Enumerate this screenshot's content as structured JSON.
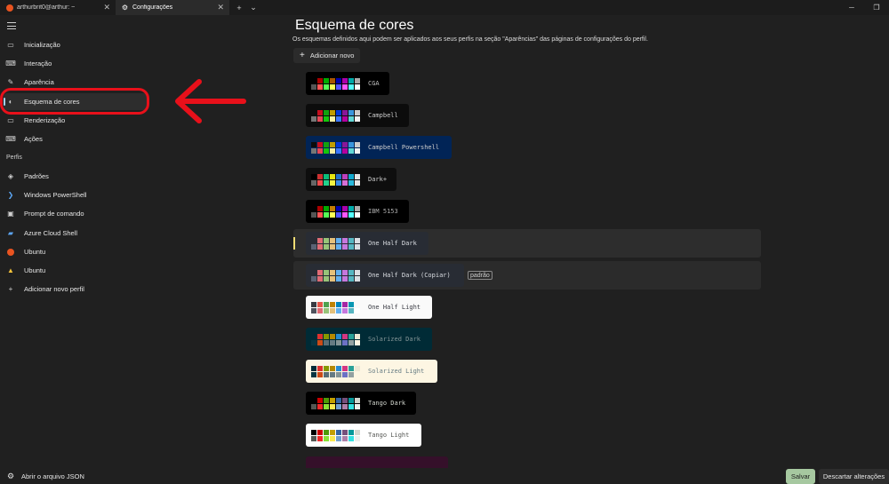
{
  "tabs": [
    {
      "label": "arthurbrit0@arthur: ~",
      "icon": "ubuntu-icon"
    },
    {
      "label": "Configurações",
      "icon": "gear-icon"
    }
  ],
  "tab_controls": {
    "new_tab": "+",
    "dropdown": "⌄"
  },
  "sidebar": {
    "items": [
      {
        "label": "Inicialização",
        "icon": "startup-icon"
      },
      {
        "label": "Interação",
        "icon": "interaction-icon"
      },
      {
        "label": "Aparência",
        "icon": "brush-icon"
      },
      {
        "label": "Esquema de cores",
        "icon": "palette-icon"
      },
      {
        "label": "Renderização",
        "icon": "monitor-icon"
      },
      {
        "label": "Ações",
        "icon": "keyboard-icon"
      }
    ],
    "profiles_label": "Perfis",
    "profiles": [
      {
        "label": "Padrões",
        "icon": "layers-icon"
      },
      {
        "label": "Windows PowerShell",
        "icon": "powershell-icon"
      },
      {
        "label": "Prompt de comando",
        "icon": "cmd-icon"
      },
      {
        "label": "Azure Cloud Shell",
        "icon": "azure-icon"
      },
      {
        "label": "Ubuntu",
        "icon": "ubuntu-icon"
      },
      {
        "label": "Ubuntu",
        "icon": "linux-icon"
      },
      {
        "label": "Adicionar novo perfil",
        "icon": "plus-icon"
      }
    ]
  },
  "main": {
    "title": "Esquema de cores",
    "description": "Os esquemas definidos aqui podem ser aplicados aos seus perfis na seção \"Aparências\" das páginas de configurações do perfil.",
    "add_new_label": "Adicionar novo",
    "schemes": [
      {
        "name": "CGA",
        "bg": "#000000",
        "fg": "#c0c0c0",
        "colors": [
          "#000000",
          "#aa0000",
          "#00aa00",
          "#aa5500",
          "#0000aa",
          "#aa00aa",
          "#00aaaa",
          "#aaaaaa",
          "#555555",
          "#ff5555",
          "#55ff55",
          "#ffff55",
          "#5555ff",
          "#ff55ff",
          "#55ffff",
          "#ffffff"
        ]
      },
      {
        "name": "Campbell",
        "bg": "#0c0c0c",
        "fg": "#cccccc",
        "colors": [
          "#0c0c0c",
          "#c50f1f",
          "#13a10e",
          "#c19c00",
          "#0037da",
          "#881798",
          "#3a96dd",
          "#cccccc",
          "#767676",
          "#e74856",
          "#16c60c",
          "#f9f1a5",
          "#3b78ff",
          "#b4009e",
          "#61d6d6",
          "#f2f2f2"
        ]
      },
      {
        "name": "Campbell Powershell",
        "bg": "#012456",
        "fg": "#cccccc",
        "colors": [
          "#0c0c0c",
          "#c50f1f",
          "#13a10e",
          "#c19c00",
          "#0037da",
          "#881798",
          "#3a96dd",
          "#cccccc",
          "#767676",
          "#e74856",
          "#16c60c",
          "#f9f1a5",
          "#3b78ff",
          "#b4009e",
          "#61d6d6",
          "#f2f2f2"
        ]
      },
      {
        "name": "Dark+",
        "bg": "#0e0e0e",
        "fg": "#cccccc",
        "colors": [
          "#000000",
          "#cd3131",
          "#0dbc79",
          "#e5e510",
          "#2472c8",
          "#bc3fbc",
          "#11a8cd",
          "#e5e5e5",
          "#666666",
          "#f14c4c",
          "#23d18b",
          "#f5f543",
          "#3b8eea",
          "#d670d6",
          "#29b8db",
          "#e5e5e5"
        ]
      },
      {
        "name": "IBM 5153",
        "bg": "#000000",
        "fg": "#aaaaaa",
        "colors": [
          "#000000",
          "#aa0000",
          "#00aa00",
          "#c47e00",
          "#0000aa",
          "#aa00aa",
          "#00aaaa",
          "#aaaaaa",
          "#555555",
          "#ff5555",
          "#55ff55",
          "#ffff55",
          "#5555ff",
          "#ff55ff",
          "#55ffff",
          "#ffffff"
        ]
      },
      {
        "name": "One Half Dark",
        "bg": "#282c34",
        "fg": "#dcdfe4",
        "colors": [
          "#282c34",
          "#e06c75",
          "#98c379",
          "#e5c07b",
          "#61afef",
          "#c678dd",
          "#56b6c2",
          "#dcdfe4",
          "#5a6374",
          "#e06c75",
          "#98c379",
          "#e5c07b",
          "#61afef",
          "#c678dd",
          "#56b6c2",
          "#dcdfe4"
        ]
      },
      {
        "name": "One Half Dark (Copiar)",
        "bg": "#282c34",
        "fg": "#dcdfe4",
        "badge": "padrão",
        "colors": [
          "#282c34",
          "#e06c75",
          "#98c379",
          "#e5c07b",
          "#61afef",
          "#c678dd",
          "#56b6c2",
          "#dcdfe4",
          "#5a6374",
          "#e06c75",
          "#98c379",
          "#e5c07b",
          "#61afef",
          "#c678dd",
          "#56b6c2",
          "#dcdfe4"
        ]
      },
      {
        "name": "One Half Light",
        "bg": "#fafafa",
        "fg": "#383a42",
        "colors": [
          "#383a42",
          "#e45649",
          "#50a14f",
          "#c18301",
          "#0184bc",
          "#a626a4",
          "#0997b3",
          "#fafafa",
          "#4f525d",
          "#df6c75",
          "#98c379",
          "#e4c07a",
          "#61afef",
          "#c577dd",
          "#56b5c1",
          "#ffffff"
        ]
      },
      {
        "name": "Solarized Dark",
        "bg": "#002b36",
        "fg": "#839496",
        "colors": [
          "#002b36",
          "#dc322f",
          "#859900",
          "#b58900",
          "#268bd2",
          "#d33682",
          "#2aa198",
          "#eee8d5",
          "#073642",
          "#cb4b16",
          "#586e75",
          "#657b83",
          "#839496",
          "#6c71c4",
          "#93a1a1",
          "#fdf6e3"
        ]
      },
      {
        "name": "Solarized Light",
        "bg": "#fdf6e3",
        "fg": "#657b83",
        "colors": [
          "#002b36",
          "#dc322f",
          "#859900",
          "#b58900",
          "#268bd2",
          "#d33682",
          "#2aa198",
          "#eee8d5",
          "#073642",
          "#cb4b16",
          "#586e75",
          "#657b83",
          "#839496",
          "#6c71c4",
          "#93a1a1",
          "#fdf6e3"
        ]
      },
      {
        "name": "Tango Dark",
        "bg": "#000000",
        "fg": "#d3d7cf",
        "colors": [
          "#000000",
          "#cc0000",
          "#4e9a06",
          "#c4a000",
          "#3465a4",
          "#75507b",
          "#06989a",
          "#d3d7cf",
          "#555753",
          "#ef2929",
          "#8ae234",
          "#fce94f",
          "#729fcf",
          "#ad7fa8",
          "#34e2e2",
          "#eeeeec"
        ]
      },
      {
        "name": "Tango Light",
        "bg": "#ffffff",
        "fg": "#555753",
        "colors": [
          "#000000",
          "#cc0000",
          "#4e9a06",
          "#c4a000",
          "#3465a4",
          "#75507b",
          "#06989a",
          "#d3d7cf",
          "#555753",
          "#ef2929",
          "#8ae234",
          "#fce94f",
          "#729fcf",
          "#ad7fa8",
          "#34e2e2",
          "#eeeeec"
        ]
      }
    ]
  },
  "footer": {
    "open_json_label": "Abrir o arquivo JSON",
    "save_label": "Salvar",
    "discard_label": "Descartar alterações"
  }
}
